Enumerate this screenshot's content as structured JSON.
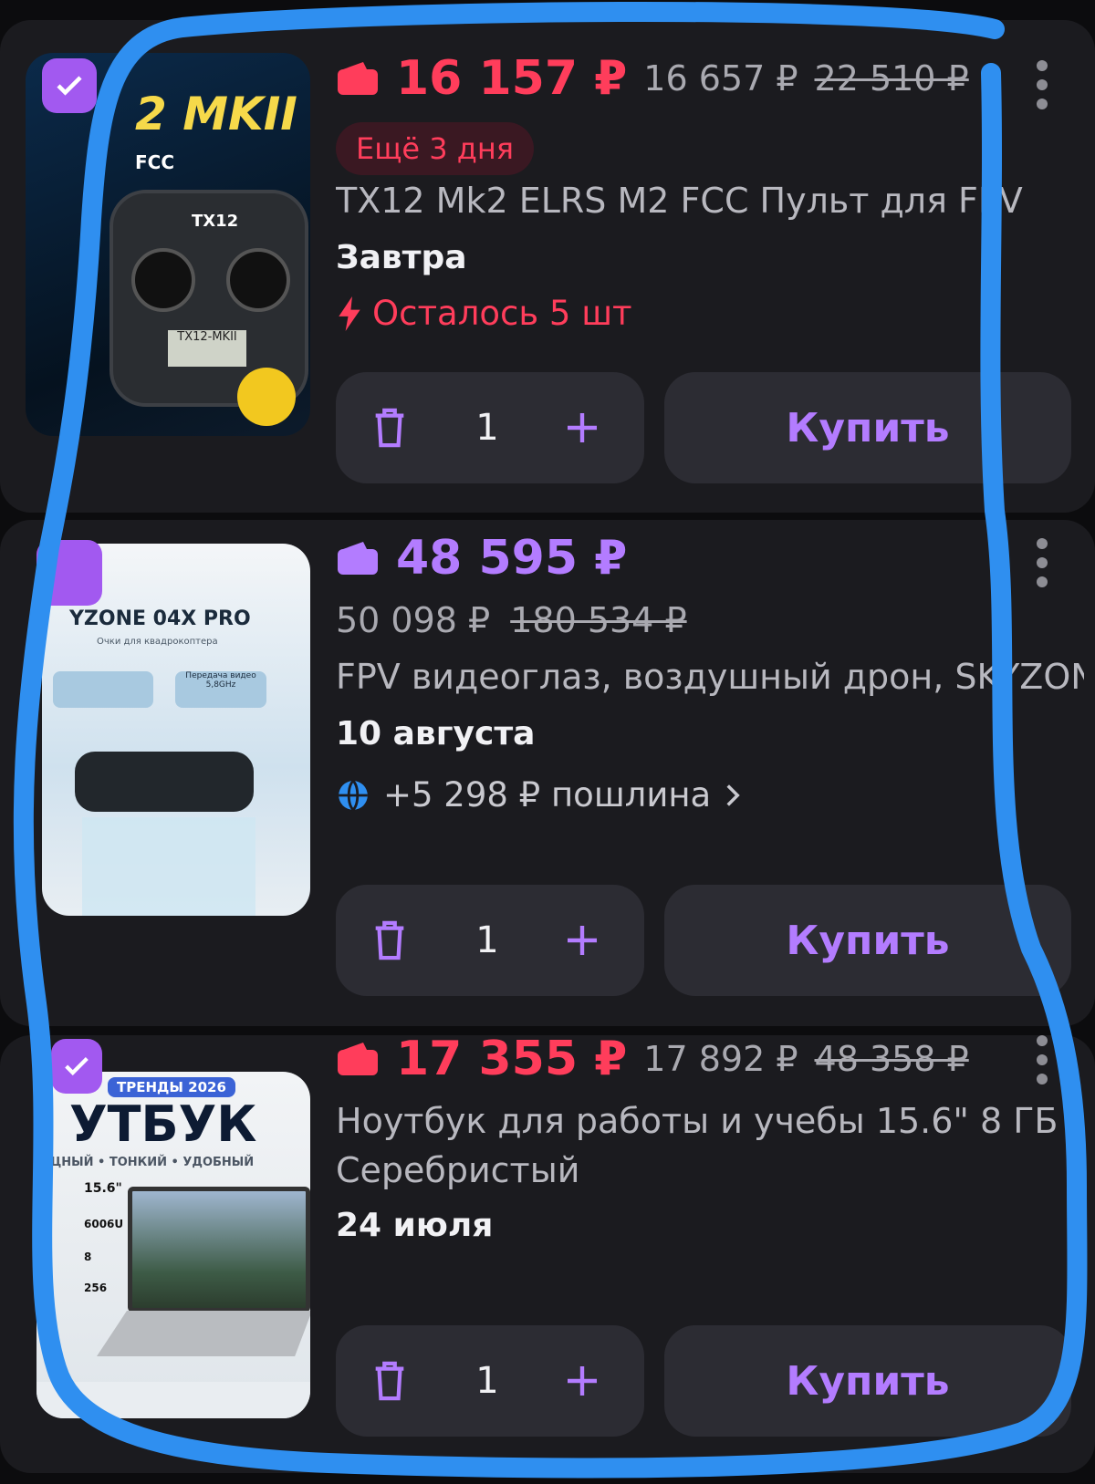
{
  "items": [
    {
      "price": "16 157 ₽",
      "price_old": "16 657 ₽",
      "price_strike": "22 510 ₽",
      "badge": "Ещё 3 дня",
      "title": "TX12 Mk2 ELRS M2 FCC Пульт для FPV",
      "delivery": "Завтра",
      "stock": "Осталось 5 шт",
      "qty": "1",
      "buy": "Купить",
      "image_text": {
        "model": "2 MKII",
        "fcc": "FCC",
        "device": "TX12",
        "screen": "TX12-MKII"
      },
      "checked": true
    },
    {
      "price": "48 595 ₽",
      "price_old": "50 098 ₽",
      "price_strike": "180 534 ₽",
      "title": "FPV видеоглаз, воздушный дрон, SKYZONE",
      "delivery": "10 августа",
      "duty": "+5 298 ₽ пошлина",
      "qty": "1",
      "buy": "Купить",
      "image_text": {
        "model": "YZONE 04X PRO",
        "sub": "Очки для квадрокоптера",
        "f1": "Передача видео 5,8GHz"
      },
      "checked": false
    },
    {
      "price": "17 355 ₽",
      "price_old": "17 892 ₽",
      "price_strike": "48 358 ₽",
      "title": "Ноутбук для работы и учебы 15.6\" 8 ГБ",
      "title2": "Серебристый",
      "delivery": "24 июля",
      "qty": "1",
      "buy": "Купить",
      "image_text": {
        "trend": "ТРЕНДЫ 2026",
        "word": "УТБУК",
        "sub": "ЩНЫЙ • ТОНКИЙ • УДОБНЫЙ",
        "spec1": "15.6\"",
        "spec2": "6006U",
        "spec3": "8",
        "spec4": "256"
      },
      "checked": true
    }
  ],
  "colors": {
    "accent": "#b37cff",
    "discount": "#ff3d5b",
    "lasso": "#2f8ff0"
  }
}
